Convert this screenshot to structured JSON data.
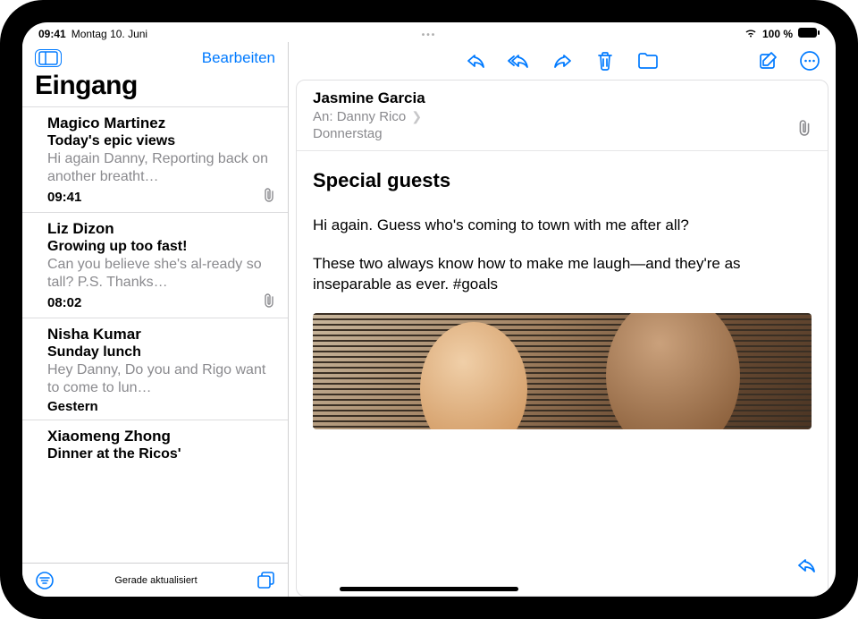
{
  "status": {
    "time": "09:41",
    "date": "Montag 10. Juni",
    "battery": "100 %"
  },
  "sidebar": {
    "edit": "Bearbeiten",
    "title": "Eingang",
    "bottom_status": "Gerade aktualisiert"
  },
  "messages": [
    {
      "sender": "Magico Martinez",
      "subject": "Today's epic views",
      "preview": "Hi again Danny, Reporting back on another breatht…",
      "time": "09:41",
      "has_attachment": true
    },
    {
      "sender": "Liz Dizon",
      "subject": "Growing up too fast!",
      "preview": "Can you believe she's al-ready so tall? P.S. Thanks…",
      "time": "08:02",
      "has_attachment": true
    },
    {
      "sender": "Nisha Kumar",
      "subject": "Sunday lunch",
      "preview": "Hey Danny, Do you and Rigo want to come to lun…",
      "time": "Gestern",
      "has_attachment": false
    },
    {
      "sender": "Xiaomeng Zhong",
      "subject": "Dinner at the Ricos'",
      "preview": "",
      "time": "",
      "has_attachment": false
    }
  ],
  "mail": {
    "from": "Jasmine Garcia",
    "to_label": "An:",
    "to_name": "Danny Rico",
    "date": "Donnerstag",
    "subject": "Special guests",
    "body": [
      "Hi again. Guess who's coming to town with me after all?",
      "These two always know how to make me laugh—and they're as inseparable as ever. #goals"
    ]
  }
}
